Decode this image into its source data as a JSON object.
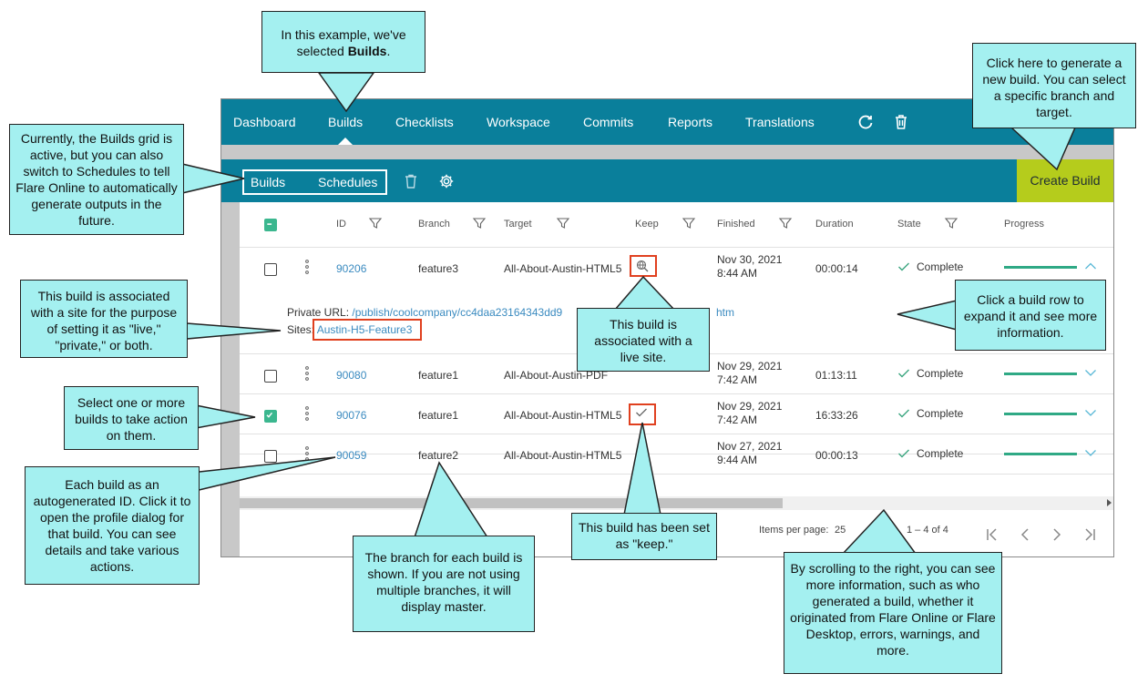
{
  "topnav": {
    "items": [
      "Dashboard",
      "Builds",
      "Checklists",
      "Workspace",
      "Commits",
      "Reports",
      "Translations"
    ],
    "active": "Builds"
  },
  "subnav": {
    "tabs": [
      "Builds",
      "Schedules"
    ],
    "active": "Builds",
    "create_build": "Create Build"
  },
  "grid": {
    "columns": [
      "ID",
      "Branch",
      "Target",
      "Keep",
      "Finished",
      "Duration",
      "State",
      "Progress"
    ],
    "rows": [
      {
        "id": "90206",
        "branch": "feature3",
        "target": "All-About-Austin-HTML5",
        "keep": "live-site",
        "finished_date": "Nov 30, 2021",
        "finished_time": "8:44 AM",
        "duration": "00:00:14",
        "state": "Complete",
        "checked": false,
        "expanded": true
      },
      {
        "id": "90080",
        "branch": "feature1",
        "target": "All-About-Austin-PDF",
        "keep": "",
        "finished_date": "Nov 29, 2021",
        "finished_time": "7:42 AM",
        "duration": "01:13:11",
        "state": "Complete",
        "checked": false
      },
      {
        "id": "90076",
        "branch": "feature1",
        "target": "All-About-Austin-HTML5",
        "keep": "keep",
        "finished_date": "Nov 29, 2021",
        "finished_time": "7:42 AM",
        "duration": "16:33:26",
        "state": "Complete",
        "checked": true
      },
      {
        "id": "90059",
        "branch": "feature2",
        "target": "All-About-Austin-HTML5",
        "keep": "",
        "finished_date": "Nov 27, 2021",
        "finished_time": "9:44 AM",
        "duration": "00:00:13",
        "state": "Complete",
        "checked": false
      }
    ],
    "expanded": {
      "private_url_label": "Private URL:",
      "private_url_start": "/publish/coolcompany/cc4daa23164343dd9",
      "private_url_end": "htm",
      "sites_label": "Sites:",
      "site": "Austin-H5-Feature3"
    },
    "pager": {
      "items_per_page_label": "Items per page:",
      "items_per_page": "25",
      "range": "1 – 4 of 4"
    }
  },
  "callouts": {
    "selected_builds_1": "In this example, we've",
    "selected_builds_2": "selected",
    "selected_builds_bold": "Builds",
    "selected_builds_end": ".",
    "create_build": "Click here to generate a new build. You can select a specific branch and target.",
    "grid_active": "Currently, the Builds grid is active, but you can also switch to Schedules to tell Flare Online to automatically generate outputs in the future.",
    "site_associated": "This build is associated with a site for the purpose of setting it as \"live,\" \"private,\" or both.",
    "live_site": "This build is associated with a live site.",
    "expand_row": "Click a build row to expand it and see more information.",
    "select_builds": "Select one or more builds to take action on them.",
    "autogen_id": "Each build as an autogenerated ID. Click it to open the profile dialog for that build. You can see details and take various actions.",
    "branch": "The branch for each build is shown. If you are not using multiple branches, it will display master.",
    "keep": "This build has been set as \"keep.\"",
    "scroll_right": "By scrolling to the right, you can see more information, such as who generated a build, whether it originated from Flare Online or Flare Desktop, errors, warnings, and more."
  },
  "colors": {
    "nav_bg": "#0a7f9b",
    "create_build_bg": "#b5cc1c",
    "callout_bg": "#a4f0f0",
    "highlight": "#e0401f",
    "progress": "#2fa985"
  }
}
